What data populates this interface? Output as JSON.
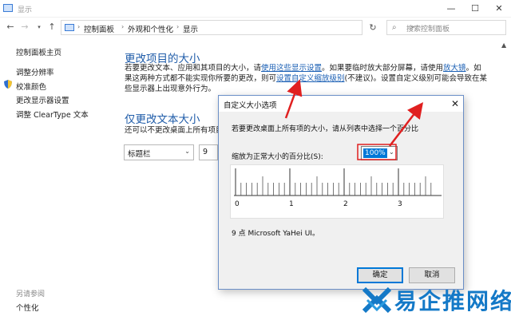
{
  "window": {
    "title": "显示",
    "controls": {
      "minimize": "—",
      "maximize": "☐",
      "close": "✕"
    }
  },
  "nav": {
    "back": "←",
    "forward": "→",
    "up": "↑",
    "breadcrumb": [
      "控制面板",
      "外观和个性化",
      "显示"
    ],
    "search_placeholder": "搜索控制面板",
    "refresh": "↻"
  },
  "sidebar": {
    "items": [
      "控制面板主页",
      "调整分辨率",
      "校准颜色",
      "更改显示器设置",
      "调整 ClearType 文本"
    ],
    "see_also_label": "另请参阅",
    "see_also_items": [
      "个性化"
    ]
  },
  "main": {
    "section1_title": "更改项目的大小",
    "section1_line1_a": "若要更改文本、应用和其项目的大小，请",
    "section1_link1": "使用这些显示设置",
    "section1_line1_b": "。如果要临时放大部分屏幕，请使用",
    "section1_link2": "放大镜",
    "section1_line1_c": "。如",
    "section1_line2_a": "果这两种方式都不能实现你所要的更改，则可",
    "section1_link3": "设置自定义缩放级别",
    "section1_line2_b": "(不建议)。设置自定义级别可能会导致在某",
    "section1_line3": "些显示器上出现意外行为。",
    "section2_title": "仅更改文本大小",
    "section2_text": "还可以不更改桌面上所有项目的",
    "element_combo": "标题栏",
    "size_combo": "9"
  },
  "dialog": {
    "title": "自定义大小选项",
    "close": "✕",
    "instruction": "若要更改桌面上所有项的大小，请从列表中选择一个百分比",
    "scale_label": "缩放为正常大小的百分比(S):",
    "scale_value": "100%",
    "ruler_labels": [
      "0",
      "1",
      "2",
      "3"
    ],
    "font_info": "9 点 Microsoft YaHei UI。",
    "ok_label": "确定",
    "cancel_label": "取消"
  },
  "watermark": {
    "text": "易企推网络"
  },
  "colors": {
    "link": "#1a5fb4",
    "heading": "#1e5ba8",
    "accent": "#0078d7",
    "arrow": "#e02020"
  }
}
